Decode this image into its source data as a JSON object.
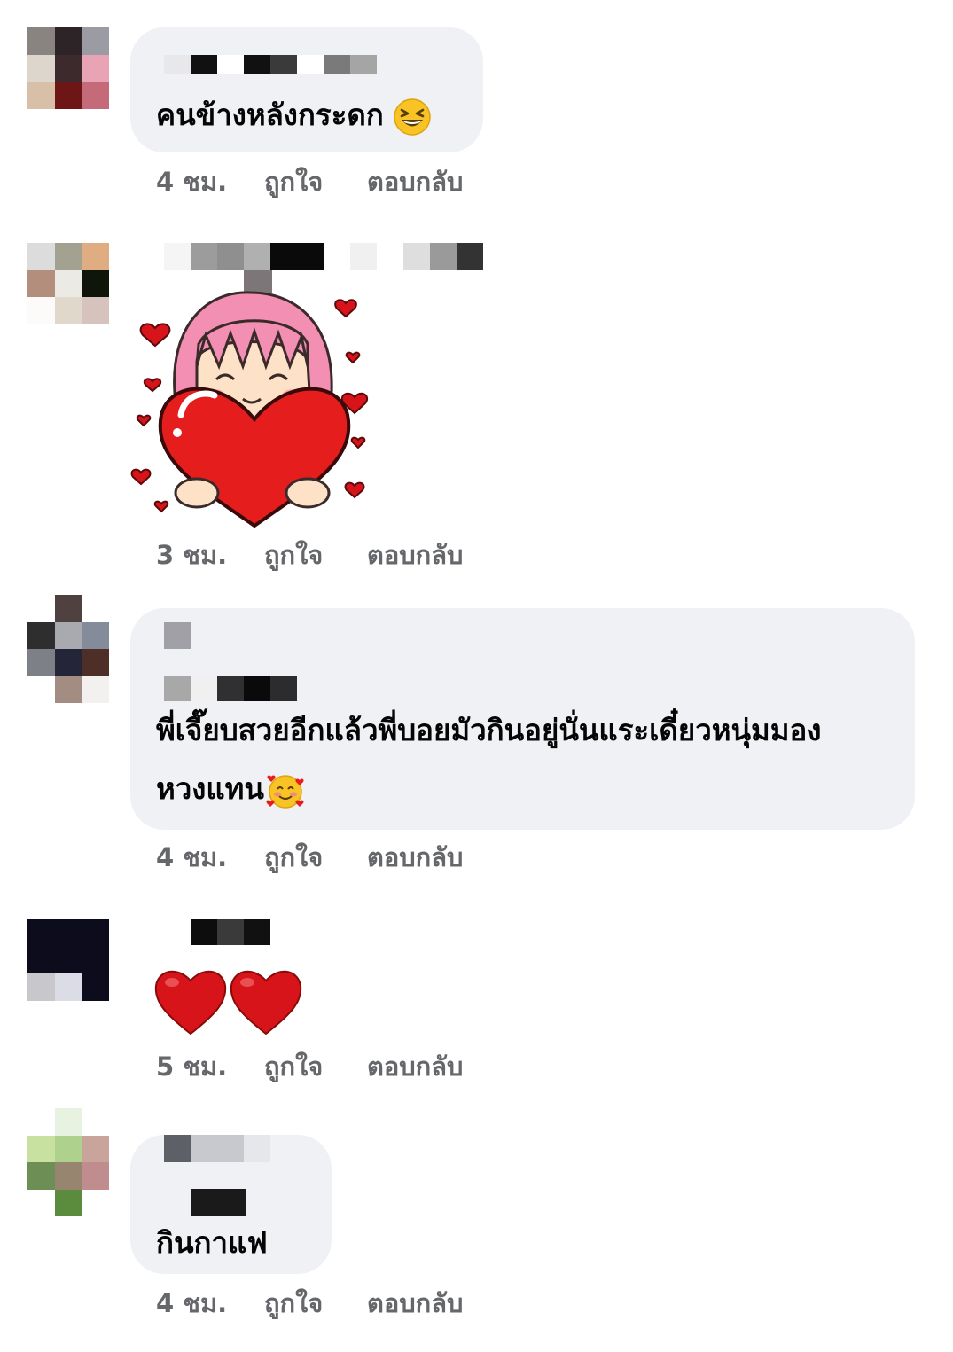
{
  "comments": [
    {
      "text": "คนข้างหลังกระดก",
      "emoji": "grinning-squinting-face",
      "time": "4 ชม.",
      "like_label": "ถูกใจ",
      "reply_label": "ตอบกลับ"
    },
    {
      "sticker": "girl-hugging-heart-sticker",
      "time": "3 ชม.",
      "like_label": "ถูกใจ",
      "reply_label": "ตอบกลับ"
    },
    {
      "text_line1": "พี่เจี๊ยบสวยอีกแล้วพี่บอยมัวกินอยู่นั่นแระเดี๋ยวหนุ่มมอง",
      "text_line2": "หวงแทน",
      "emoji": "smiling-face-with-hearts",
      "time": "4 ชม.",
      "like_label": "ถูกใจ",
      "reply_label": "ตอบกลับ"
    },
    {
      "emoji": "red-heart-x2",
      "time": "5 ชม.",
      "like_label": "ถูกใจ",
      "reply_label": "ตอบกลับ"
    },
    {
      "text": "กินกาแฟ",
      "time": "4 ชม.",
      "like_label": "ถูกใจ",
      "reply_label": "ตอบกลับ"
    }
  ],
  "colors": {
    "bubble": "#f0f1f5",
    "meta_text": "#65676b",
    "body_text": "#050505",
    "heart_red": "#d7141a"
  }
}
